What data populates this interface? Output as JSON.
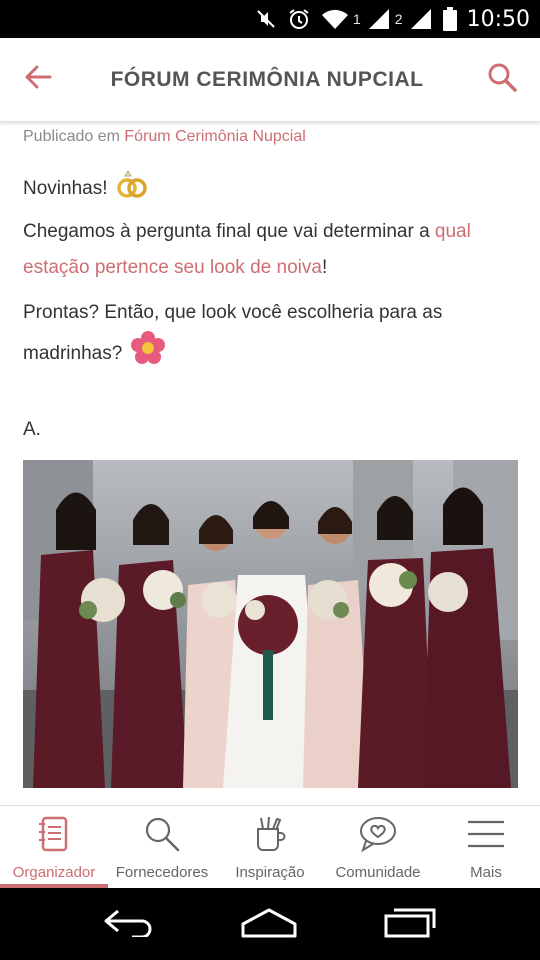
{
  "status_bar": {
    "sim1": "1",
    "sim2": "2",
    "time": "10:50"
  },
  "header": {
    "title": "FÓRUM CERIMÔNIA NUPCIAL",
    "back_icon": "arrow-left-icon",
    "search_icon": "search-icon"
  },
  "post": {
    "published_prefix": "Publicado em",
    "forum_name": "Fórum Cerimônia Nupcial",
    "greeting": "Novinhas!",
    "question_part1": "Chegamos à pergunta final que vai determinar a",
    "question_link": "qual estação pertence seu look de noiva",
    "question_end": "!",
    "prompt": "Prontas? Então, que look você escolheria para as madrinhas?",
    "option_label": "A."
  },
  "bottom_nav": {
    "items": [
      {
        "label": "Organizador",
        "icon": "notebook-icon",
        "active": true
      },
      {
        "label": "Fornecedores",
        "icon": "search-icon",
        "active": false
      },
      {
        "label": "Inspiração",
        "icon": "brush-cup-icon",
        "active": false
      },
      {
        "label": "Comunidade",
        "icon": "chat-heart-icon",
        "active": false
      },
      {
        "label": "Mais",
        "icon": "menu-icon",
        "active": false
      }
    ]
  },
  "colors": {
    "accent": "#cd6e72",
    "title_text": "#555555",
    "body_text": "#333333",
    "burgundy_dress": "#5a1a26",
    "blush_dress": "#ecd3cc"
  }
}
